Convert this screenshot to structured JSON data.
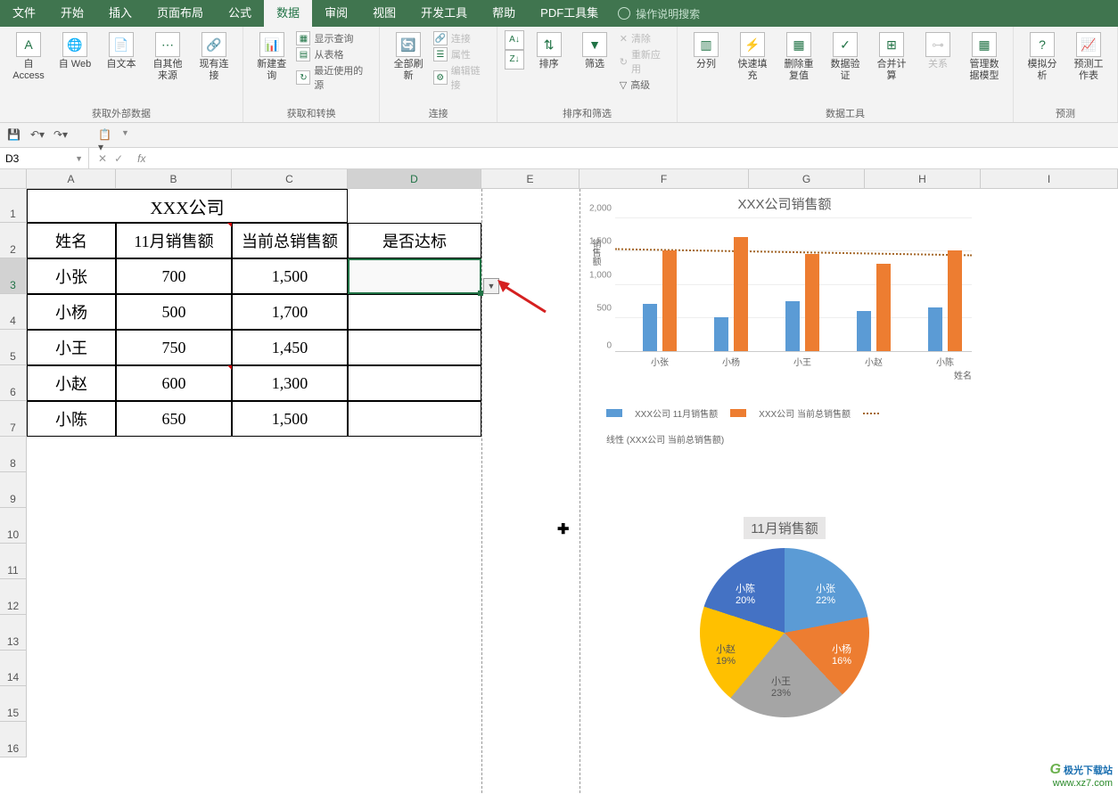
{
  "menu": {
    "tabs": [
      "文件",
      "开始",
      "插入",
      "页面布局",
      "公式",
      "数据",
      "审阅",
      "视图",
      "开发工具",
      "帮助",
      "PDF工具集"
    ],
    "active_index": 5,
    "tell_me": "操作说明搜索"
  },
  "ribbon": {
    "groups": {
      "g0": {
        "label": "获取外部数据",
        "items": [
          "自 Access",
          "自 Web",
          "自文本",
          "自其他来源",
          "现有连接"
        ]
      },
      "g1": {
        "label": "获取和转换",
        "items": [
          "新建查询",
          "显示查询",
          "从表格",
          "最近使用的源"
        ]
      },
      "g2": {
        "label": "连接",
        "items": [
          "全部刷新",
          "连接",
          "属性",
          "编辑链接"
        ]
      },
      "g3": {
        "label": "排序和筛选",
        "items": [
          "排序",
          "筛选",
          "清除",
          "重新应用",
          "高级"
        ]
      },
      "g4": {
        "label": "数据工具",
        "items": [
          "分列",
          "快速填充",
          "删除重复值",
          "数据验证",
          "合并计算",
          "关系",
          "管理数据模型"
        ]
      },
      "g5": {
        "label": "预测",
        "items": [
          "模拟分析",
          "预测工作表"
        ]
      }
    },
    "sort_az": "A→Z",
    "sort_za": "Z→A"
  },
  "namebox": "D3",
  "formula_bar": "",
  "columns": [
    "A",
    "B",
    "C",
    "D",
    "E",
    "F",
    "G",
    "H",
    "I"
  ],
  "rows": [
    "1",
    "2",
    "3",
    "4",
    "5",
    "6",
    "7",
    "8",
    "9",
    "10",
    "11",
    "12",
    "13",
    "14",
    "15",
    "16"
  ],
  "table": {
    "title": "XXX公司",
    "headers": {
      "A": "姓名",
      "B": "11月销售额",
      "C": "当前总销售额",
      "D": "是否达标"
    },
    "data": [
      {
        "A": "小张",
        "B": "700",
        "C": "1,500",
        "D": ""
      },
      {
        "A": "小杨",
        "B": "500",
        "C": "1,700",
        "D": ""
      },
      {
        "A": "小王",
        "B": "750",
        "C": "1,450",
        "D": ""
      },
      {
        "A": "小赵",
        "B": "600",
        "C": "1,300",
        "D": ""
      },
      {
        "A": "小陈",
        "B": "650",
        "C": "1,500",
        "D": ""
      }
    ]
  },
  "chart_data": [
    {
      "type": "bar",
      "title": "XXX公司销售额",
      "categories": [
        "小张",
        "小杨",
        "小王",
        "小赵",
        "小陈"
      ],
      "series": [
        {
          "name": "XXX公司 11月销售额",
          "values": [
            700,
            500,
            750,
            600,
            650
          ],
          "color": "#5b9bd5"
        },
        {
          "name": "XXX公司 当前总销售额",
          "values": [
            1500,
            1700,
            1450,
            1300,
            1500
          ],
          "color": "#ed7d31"
        }
      ],
      "trendline": {
        "name": "线性 (XXX公司 当前总销售额)",
        "style": "dotted",
        "color": "#a5682a"
      },
      "ylabel": "销售额",
      "xlabel": "姓名",
      "ylim": [
        0,
        2000
      ],
      "yticks": [
        0,
        500,
        1000,
        1500,
        2000
      ]
    },
    {
      "type": "pie",
      "title": "11月销售额",
      "categories": [
        "小张",
        "小杨",
        "小王",
        "小赵",
        "小陈"
      ],
      "values": [
        700,
        500,
        750,
        600,
        650
      ],
      "percent_labels": [
        "22%",
        "16%",
        "23%",
        "19%",
        "20%"
      ],
      "colors": [
        "#5b9bd5",
        "#ed7d31",
        "#a5a5a5",
        "#ffc000",
        "#4472c4"
      ]
    }
  ],
  "watermark": {
    "l1": "极光下载站",
    "l2": "www.xz7.com"
  }
}
